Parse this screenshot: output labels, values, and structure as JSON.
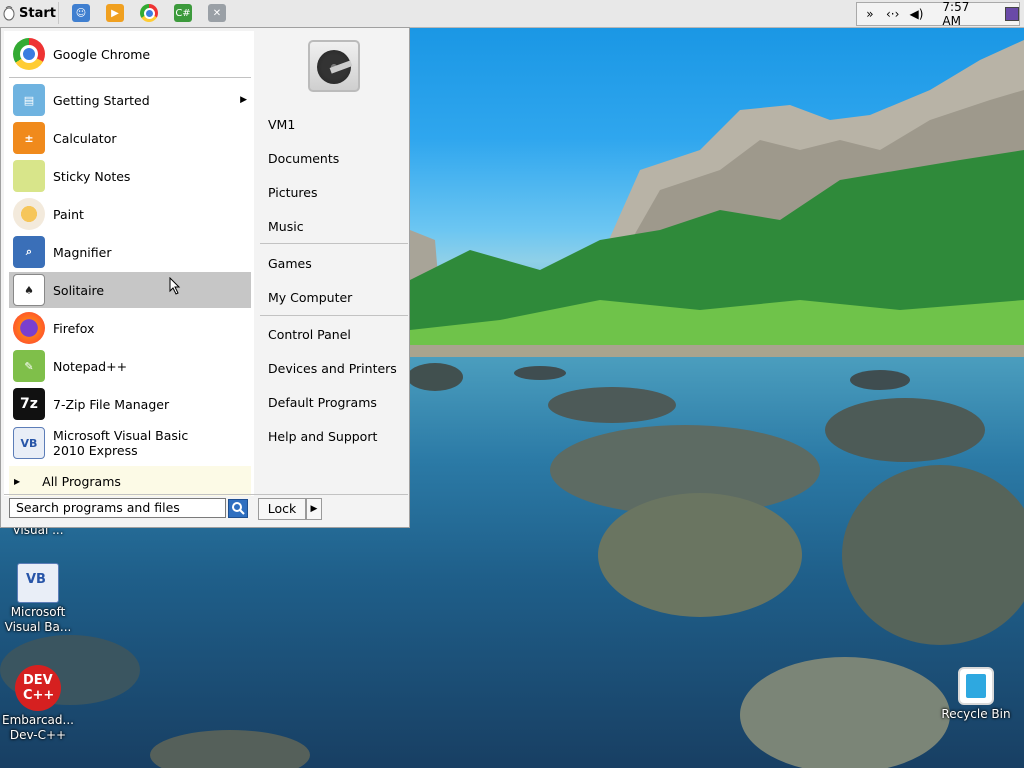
{
  "taskbar": {
    "start_label": "Start",
    "clock": "7:57 AM",
    "tray_glyphs": [
      "»",
      "<·>",
      "🔊"
    ]
  },
  "start_menu": {
    "apps": [
      {
        "label": "Google Chrome",
        "icon": "chrome-icon"
      },
      {
        "label": "Getting Started",
        "icon": "getting-started-icon",
        "has_submenu": true
      },
      {
        "label": "Calculator",
        "icon": "calculator-icon"
      },
      {
        "label": "Sticky Notes",
        "icon": "sticky-notes-icon"
      },
      {
        "label": "Paint",
        "icon": "paint-icon"
      },
      {
        "label": "Magnifier",
        "icon": "magnifier-icon"
      },
      {
        "label": "Solitaire",
        "icon": "solitaire-icon",
        "highlighted": true
      },
      {
        "label": "Firefox",
        "icon": "firefox-icon"
      },
      {
        "label": "Notepad++",
        "icon": "notepadpp-icon"
      },
      {
        "label": "7-Zip File Manager",
        "icon": "7zip-icon",
        "icon_text": "7z"
      },
      {
        "label": "Microsoft Visual Basic 2010 Express",
        "icon": "visual-basic-icon",
        "icon_text": "VB"
      }
    ],
    "all_programs": "All Programs",
    "places": {
      "user": "VM1",
      "documents": "Documents",
      "pictures": "Pictures",
      "music": "Music",
      "games": "Games",
      "computer": "My Computer",
      "control_panel": "Control Panel",
      "devices": "Devices and Printers",
      "default_programs": "Default Programs",
      "help": "Help and Support"
    },
    "search_placeholder": "Search programs and files",
    "lock_label": "Lock"
  },
  "desktop_icons": {
    "partial_label": "Visual ...",
    "vb": {
      "line1": "Microsoft",
      "line2": "Visual Ba...",
      "icon_text": "VB"
    },
    "devcpp": {
      "line1": "Embarcad...",
      "line2": "Dev-C++",
      "icon_text1": "DEV",
      "icon_text2": "C++"
    },
    "recycle": {
      "label": "Recycle Bin"
    }
  },
  "colors": {
    "menu_bg": "#f3f3f3",
    "highlight": "#c6c6c6",
    "all_programs_bg": "#fcfae6",
    "accent_blue": "#2f6fc0"
  }
}
